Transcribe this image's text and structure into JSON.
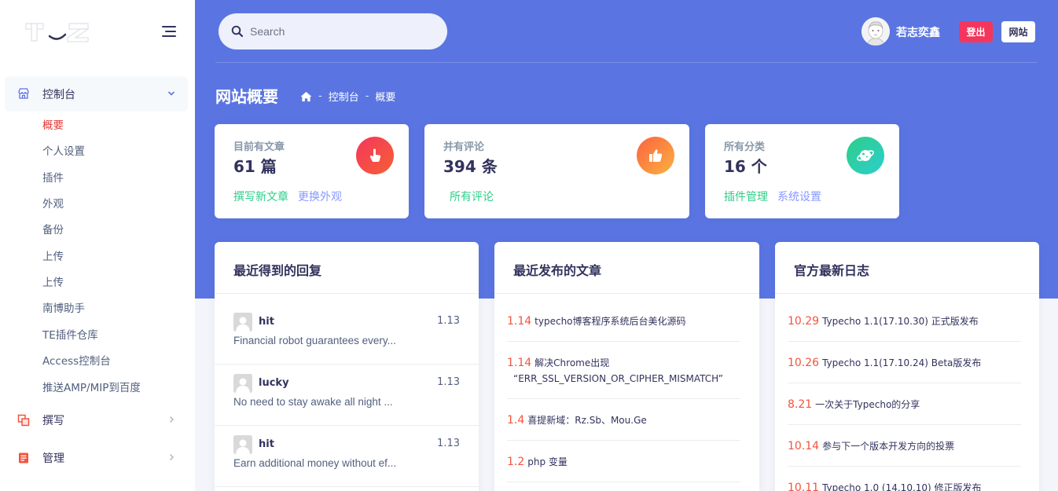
{
  "sidebar": {
    "groups": [
      {
        "label": "控制台",
        "icon": "shop-icon",
        "expanded": true
      },
      {
        "label": "撰写",
        "icon": "write-icon"
      },
      {
        "label": "管理",
        "icon": "manage-icon"
      }
    ],
    "items": [
      "概要",
      "个人设置",
      "插件",
      "外观",
      "备份",
      "上传",
      "上传",
      "南博助手",
      "TE插件仓库",
      "Access控制台",
      "推送AMP/MIP到百度"
    ],
    "active_item": "概要"
  },
  "header": {
    "search_placeholder": "Search",
    "username": "若志奕鑫",
    "logout_label": "登出",
    "site_label": "网站"
  },
  "page": {
    "title": "网站概要",
    "breadcrumb": [
      "控制台",
      "概要"
    ]
  },
  "stats": [
    {
      "label": "目前有文章",
      "value": "61 篇",
      "links": [
        "撰写新文章",
        "更换外观"
      ],
      "icon": "hand-pointer-icon",
      "color": "#f5365c"
    },
    {
      "label": "并有评论",
      "value": "394 条",
      "links": [
        "所有评论"
      ],
      "icon": "thumbs-up-icon",
      "color": "#fb6340"
    },
    {
      "label": "所有分类",
      "value": "16 个",
      "links": [
        "插件管理",
        "系统设置"
      ],
      "icon": "planet-icon",
      "color": "#2dce89"
    }
  ],
  "replies": {
    "title": "最近得到的回复",
    "items": [
      {
        "name": "hit",
        "date": "1.13",
        "text": "Financial robot guarantees every..."
      },
      {
        "name": "lucky",
        "date": "1.13",
        "text": "No need to stay awake all night ..."
      },
      {
        "name": "hit",
        "date": "1.13",
        "text": "Earn additional money without ef..."
      }
    ]
  },
  "posts": {
    "title": "最近发布的文章",
    "items": [
      {
        "date": "1.14",
        "title": "typecho博客程序系统后台美化源码"
      },
      {
        "date": "1.14",
        "title": "解决Chrome出现",
        "title2": "“ERR_SSL_VERSION_OR_CIPHER_MISMATCH”"
      },
      {
        "date": "1.4",
        "title": "喜提新域：Rz.Sb、Mou.Ge"
      },
      {
        "date": "1.2",
        "title": "php 变量"
      }
    ]
  },
  "logs": {
    "title": "官方最新日志",
    "items": [
      {
        "date": "10.29",
        "title": "Typecho 1.1(17.10.30) 正式版发布"
      },
      {
        "date": "10.26",
        "title": "Typecho 1.1(17.10.24) Beta版发布"
      },
      {
        "date": "8.21",
        "title": "一次关于Typecho的分享"
      },
      {
        "date": "10.14",
        "title": "参与下一个版本开发方向的投票"
      },
      {
        "date": "10.11",
        "title": "Typecho 1.0 (14.10.10) 修正版发布"
      }
    ]
  }
}
